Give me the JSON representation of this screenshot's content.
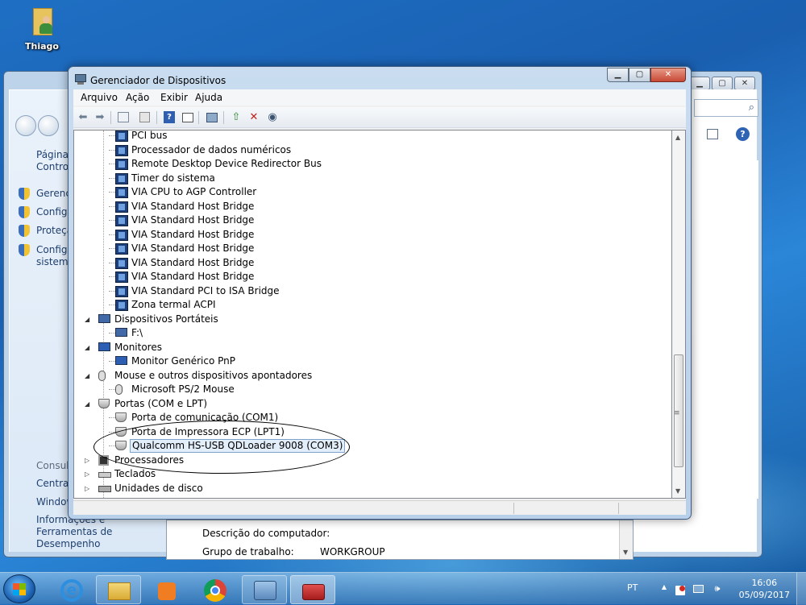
{
  "desktop": {
    "icon_label": "Thiago"
  },
  "bg_window": {
    "sidebar": [
      {
        "label": "Página I",
        "label2": "Control"
      },
      {
        "label": "Gerencia"
      },
      {
        "label": "Configu"
      },
      {
        "label": "Proteçã"
      },
      {
        "label": "Configu",
        "label2": "sistema"
      }
    ],
    "see_also": [
      "Consult",
      "Central",
      "Window",
      "Informações e Ferramentas de",
      "Desempenho"
    ],
    "rows": [
      {
        "label": "Descrição do computador:",
        "value": ""
      },
      {
        "label": "Grupo de trabalho:",
        "value": "WORKGROUP"
      }
    ],
    "help_glyph": "?",
    "search_glyph": "⌕"
  },
  "window": {
    "title": "Gerenciador de Dispositivos",
    "caption": {
      "minimize": "▁",
      "maximize": "▢",
      "close": "✕"
    },
    "menu": [
      "Arquivo",
      "Ação",
      "Exibir",
      "Ajuda"
    ],
    "toolbar": [
      "back",
      "forward",
      "properties",
      "show-hidden",
      "help",
      "view",
      "scan",
      "update-driver",
      "uninstall",
      "enable"
    ]
  },
  "tree": {
    "items": [
      {
        "label": "PCI bus",
        "level": 2,
        "icon": "chip-icon"
      },
      {
        "label": "Processador de dados numéricos",
        "level": 2,
        "icon": "chip-icon"
      },
      {
        "label": "Remote Desktop Device Redirector Bus",
        "level": 2,
        "icon": "chip-icon"
      },
      {
        "label": "Timer do sistema",
        "level": 2,
        "icon": "chip-icon"
      },
      {
        "label": "VIA CPU to AGP Controller",
        "level": 2,
        "icon": "chip-icon"
      },
      {
        "label": "VIA Standard Host Bridge",
        "level": 2,
        "icon": "chip-icon"
      },
      {
        "label": "VIA Standard Host Bridge",
        "level": 2,
        "icon": "chip-icon"
      },
      {
        "label": "VIA Standard Host Bridge",
        "level": 2,
        "icon": "chip-icon"
      },
      {
        "label": "VIA Standard Host Bridge",
        "level": 2,
        "icon": "chip-icon"
      },
      {
        "label": "VIA Standard Host Bridge",
        "level": 2,
        "icon": "chip-icon"
      },
      {
        "label": "VIA Standard Host Bridge",
        "level": 2,
        "icon": "chip-icon"
      },
      {
        "label": "VIA Standard PCI to ISA Bridge",
        "level": 2,
        "icon": "chip-icon"
      },
      {
        "label": "Zona termal ACPI",
        "level": 2,
        "icon": "chip-icon"
      },
      {
        "label": "Dispositivos Portáteis",
        "level": 1,
        "icon": "portable-device-icon",
        "expanded": true
      },
      {
        "label": "F:\\",
        "level": 2,
        "icon": "portable-device-icon"
      },
      {
        "label": "Monitores",
        "level": 1,
        "icon": "monitor-icon",
        "expanded": true
      },
      {
        "label": "Monitor Genérico PnP",
        "level": 2,
        "icon": "monitor-icon"
      },
      {
        "label": "Mouse e outros dispositivos apontadores",
        "level": 1,
        "icon": "mouse-icon",
        "expanded": true
      },
      {
        "label": "Microsoft PS/2 Mouse",
        "level": 2,
        "icon": "mouse-icon"
      },
      {
        "label": "Portas (COM e LPT)",
        "level": 1,
        "icon": "port-icon",
        "expanded": true
      },
      {
        "label": "Porta de comunicação (COM1)",
        "level": 2,
        "icon": "port-icon"
      },
      {
        "label": "Porta de Impressora ECP (LPT1)",
        "level": 2,
        "icon": "port-icon"
      },
      {
        "label": "Qualcomm HS-USB QDLoader 9008 (COM3)",
        "level": 2,
        "icon": "port-icon",
        "selected": true
      },
      {
        "label": "Processadores",
        "level": 1,
        "icon": "cpu-icon",
        "expanded": false
      },
      {
        "label": "Teclados",
        "level": 1,
        "icon": "keyboard-icon",
        "expanded": false
      },
      {
        "label": "Unidades de disco",
        "level": 1,
        "icon": "disk-icon",
        "expanded": false
      }
    ]
  },
  "scrollbar": {
    "up": "▲",
    "down": "▼",
    "grip": "≡"
  },
  "taskbar": {
    "apps": [
      "internet-explorer",
      "file-explorer",
      "media-player",
      "chrome",
      "control-panel",
      "device-manager"
    ],
    "language": "PT",
    "time": "16:06",
    "date": "05/09/2017",
    "tray_glyphs": {
      "arrow": "▲",
      "volume": "🕪"
    }
  }
}
